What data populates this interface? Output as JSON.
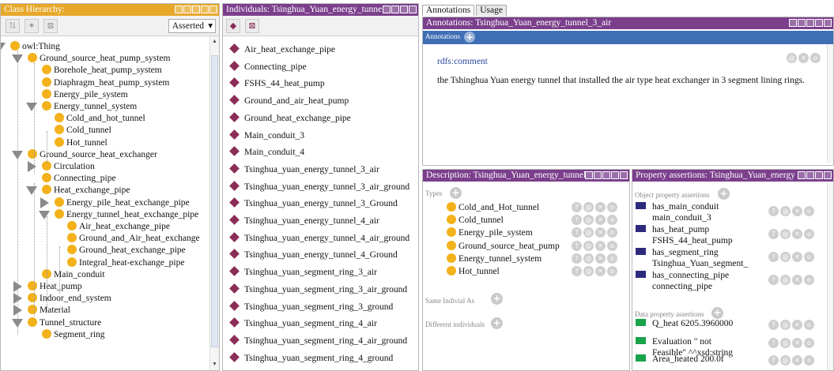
{
  "class_panel": {
    "title": "Class Hierarchy:",
    "mode": "Asserted",
    "toolbar_icons": [
      "add-subclass-icon",
      "add-sibling-icon",
      "delete-class-icon"
    ],
    "nodes": [
      "owl:Thing",
      "Ground_source_heat_pump_system",
      "Borehole_heat_pump_system",
      "Diaphragm_heat_pump_system",
      "Energy_pile_system",
      "Energy_tunnel_system",
      "Cold_and_hot_tunnel",
      "Cold_tunnel",
      "Hot_tunnel",
      "Ground_source_heat_exchanger",
      "Circulation",
      "Connecting_pipe",
      "Heat_exchange_pipe",
      "Energy_pile_heat_exchange_pipe",
      "Energy_tunnel_heat_exchange_pipe",
      "Air_heat_exchange_pipe",
      "Ground_and_Air_heat_exchange",
      "Ground_heat_exchange_pipe",
      "Integral_heat-exchange_pipe",
      "Main_conduit",
      "Heat_pump",
      "Indoor_end_system",
      "Material",
      "Tunnel_structure",
      "Segment_ring"
    ]
  },
  "individuals_panel": {
    "title": "Individuals: Tsinghua_Yuan_energy_tunne",
    "items": [
      "Air_heat_exchange_pipe",
      "Connecting_pipe",
      "FSHS_44_heat_pump",
      "Ground_and_air_heat_pump",
      "Ground_heat_exchange_pipe",
      "Main_conduit_3",
      "Main_conduit_4",
      "Tsinghua_yuan_energy_tunnel_3_air",
      "Tsinghua_yuan_energy_tunnel_3_air_ground",
      "Tsinghua_yuan_energy_tunnel_3_Ground",
      "Tsinghua_yuan_energy_tunnel_4_air",
      "Tsinghua_yuan_energy_tunnel_4_air_ground",
      "Tsinghua_yuan_energy_tunnel_4_Ground",
      "Tsinghua_yuan_segment_ring_3_air",
      "Tsinghua_yuan_segment_ring_3_air_ground",
      "Tsinghua_yuan_segment_ring_3_ground",
      "Tsinghua_yuan_segment_ring_4_air",
      "Tsinghua_yuan_segment_ring_4_air_ground",
      "Tsinghua_yuan_segment_ring_4_ground"
    ]
  },
  "tabs": [
    "Annotations",
    "Usage"
  ],
  "annotations_panel": {
    "title": "Annotations: Tsinghua_Yuan_energy_tunnel_3_air",
    "section": "Annotations",
    "property": "rdfs:comment",
    "value": "the Tshinghua Yuan energy tunnel that installed the air type heat exchanger in 3 segment lining rings."
  },
  "description_panel": {
    "title": "Description: Tsinghua_Yuan_energy_tunnel",
    "types_label": "Types",
    "types": [
      "Cold_and_Hot_tunnel",
      "Cold_tunnel",
      "Energy_pile_system",
      "Ground_source_heat_pump",
      "Energy_tunnel_system",
      "Hot_tunnel"
    ],
    "same_label": "Same Indivial As",
    "different_label": "Different individuals"
  },
  "property_panel": {
    "title": "Property assertions: Tsinghua_Yuan_energy",
    "object_label": "Object property assertions",
    "object_props": [
      {
        "line1": "has_main_conduit",
        "line2": "main_conduit_3"
      },
      {
        "line1": "has_heat_pump",
        "line2": "FSHS_44_heat_pump"
      },
      {
        "line1": "has_segment_ring",
        "line2": "Tsinghua_Yuan_segment_"
      },
      {
        "line1": "has_connecting_pipe",
        "line2": "connecting_pipe"
      }
    ],
    "data_label": "Data property assertions",
    "data_props": [
      {
        "line1": "Q_heat 6205.3960000",
        "line2": ""
      },
      {
        "line1": "Evaluation \" not",
        "line2": "Feasible\" ^^xsd:string"
      },
      {
        "line1": "Area_heated 200.0f",
        "line2": ""
      }
    ]
  },
  "colors": {
    "orange": "#e7a82a",
    "purple": "#7b3f8c",
    "class_dot": "#f3b21b",
    "individual": "#8b2d57",
    "object_prop": "#2d2a7e",
    "data_prop": "#19a34a"
  }
}
